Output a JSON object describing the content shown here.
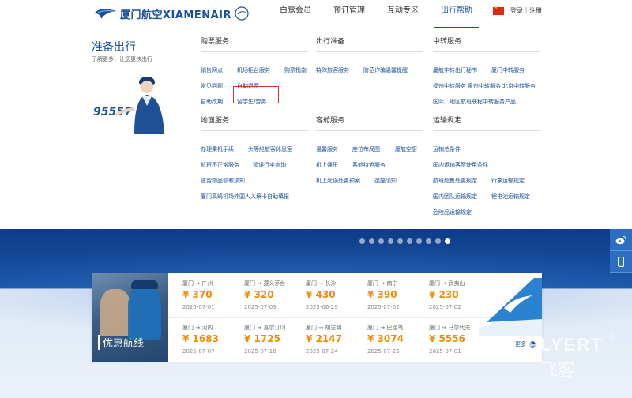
{
  "header": {
    "logo_text": "厦门航空XIAMENAIR",
    "nav": [
      {
        "label": "白鹭会员",
        "active": false
      },
      {
        "label": "预订管理",
        "active": false
      },
      {
        "label": "互动专区",
        "active": false
      },
      {
        "label": "出行帮助",
        "active": true
      }
    ],
    "flag_icon": "china-flag-icon",
    "login_label": "登录｜注册"
  },
  "panel": {
    "intro_title": "准备出行",
    "intro_subtitle": "了解更多，让您更快出行",
    "hotline": "95557",
    "sections": {
      "ticket": {
        "title": "购票服务",
        "links": [
          "销售网点",
          "机场柜台服务",
          "购票指南",
          "常见问题",
          "自助退票",
          "自助改期",
          "留学生/劳务"
        ]
      },
      "prepare": {
        "title": "出行准备",
        "links": [
          "特殊旅客服务",
          "防范诈骗温馨提醒"
        ]
      },
      "transfer": {
        "title": "中转服务",
        "links": [
          "厦航中转出行秘书",
          "厦门中转服务",
          "福州中转服务",
          "泉州中转服务",
          "北京中转服务",
          "国际、地区航班联程中转服务产品"
        ]
      },
      "ground": {
        "title": "地面服务",
        "links": [
          "办理乘机手续",
          "头等舱旅客休息室",
          "航班不正常服务",
          "延误行李查询",
          "遗留物品领取须知",
          "厦门高崎机场外国人入境卡自助填报"
        ]
      },
      "cabin": {
        "title": "客舱服务",
        "links": [
          "温馨服务",
          "座位布局图",
          "厦航空厨",
          "机上娱乐",
          "客舱特色服务",
          "机上延误处置预案",
          "选座须知"
        ]
      },
      "transport": {
        "title": "运输规定",
        "links": [
          "运输总条件",
          "国内运输客票使用条件",
          "航班超售处置规定",
          "行李运输规定",
          "国内团队运输规定",
          "锂电池运输规定",
          "危险品运输规定"
        ]
      }
    }
  },
  "banner": {
    "slide_count": 10,
    "active_slide": 10,
    "side_tools": [
      "weibo-icon",
      "mobile-icon"
    ],
    "deals_label": "优惠航线",
    "deals": [
      {
        "route": "厦门 → 广州",
        "price": "¥ 370",
        "date": "2025-07-01"
      },
      {
        "route": "厦门 → 遵义茅台",
        "price": "¥ 320",
        "date": "2025-07-03"
      },
      {
        "route": "厦门 → 长沙",
        "price": "¥ 430",
        "date": "2025-06-29"
      },
      {
        "route": "厦门 → 南宁",
        "price": "¥ 390",
        "date": "2025-07-02"
      },
      {
        "route": "厦门 → 武夷山",
        "price": "¥ 230",
        "date": "2025-07-02"
      },
      {
        "route": "厦门 → 河内",
        "price": "¥ 1683",
        "date": "2025-07-07"
      },
      {
        "route": "厦门 → 喜尔汀川",
        "price": "¥ 1725",
        "date": "2025-07-16"
      },
      {
        "route": "厦门 → 胡志明",
        "price": "¥ 2147",
        "date": "2025-07-24"
      },
      {
        "route": "厦门 → 巴厘岛",
        "price": "¥ 3074",
        "date": "2025-07-25"
      },
      {
        "route": "厦门 → 马尔代夫",
        "price": "¥ 5556",
        "date": "2025-07-01"
      }
    ],
    "more_label": "更多"
  },
  "colors": {
    "brand": "#1a4f9c",
    "price": "#f08c00",
    "highlight": "#d9322b"
  }
}
